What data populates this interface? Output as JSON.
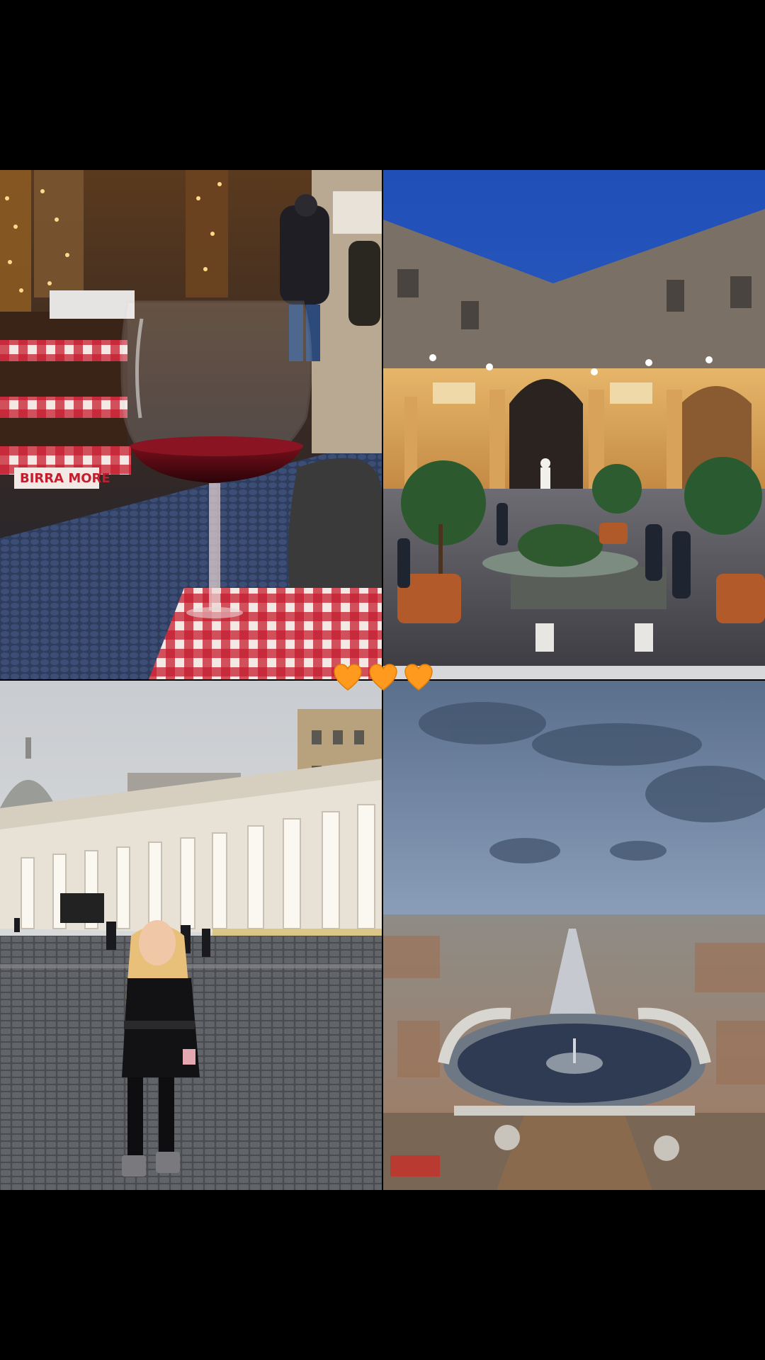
{
  "story": {
    "background_color": "#000000",
    "sticker": {
      "type": "emoji-row",
      "icon": "orange-heart-icon",
      "count": 3,
      "color": "#FF9A1F"
    },
    "photos": [
      {
        "position": "top-left",
        "subject": "wine-glass-cafe-street",
        "sign_text": "BIRRA MORE"
      },
      {
        "position": "top-right",
        "subject": "vatican-courtyard-night"
      },
      {
        "position": "bottom-left",
        "subject": "woman-st-peters-square"
      },
      {
        "position": "bottom-right",
        "subject": "aerial-view-st-peters-square"
      }
    ]
  }
}
